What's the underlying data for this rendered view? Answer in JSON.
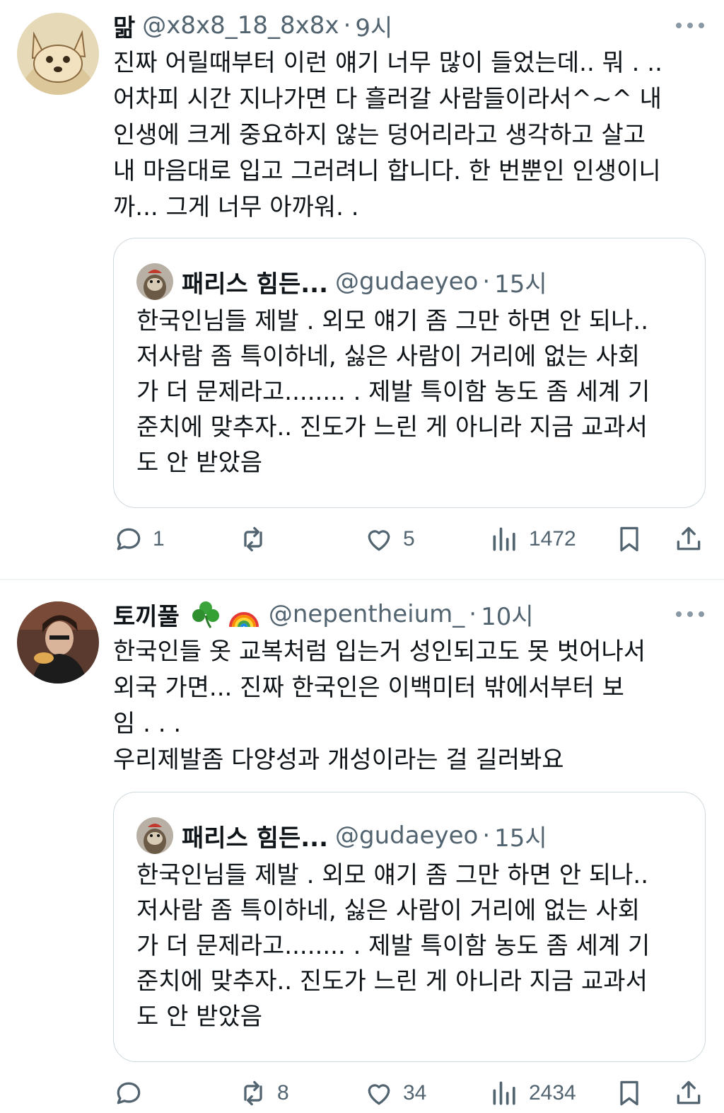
{
  "tweets": [
    {
      "author": "맒",
      "handle": "@x8x8_18_8x8x",
      "dot": "·",
      "time": "9시",
      "body_lines": [
        "진짜 어릴때부터 이런 얘기 너무 많이 들었는데.. 뭐 . ..",
        "어차피 시간 지나가면 다 흘러갈 사람들이라서^~^ 내",
        "인생에 크게 중요하지 않는 덩어리라고 생각하고 살고",
        "내 마음대로 입고 그러려니 합니다. 한 번뿐인 인생이니",
        "까... 그게 너무 아까워. ."
      ],
      "quote": {
        "author": "패리스 힘든...",
        "handle": "@gudaeyeo",
        "dot": "·",
        "time": "15시",
        "lines": [
          "한국인님들 제발 . 외모 얘기 좀 그만 하면 안 되나..",
          "저사람 좀 특이하네, 싫은 사람이 거리에 없는 사회",
          "가 더 문제라고........ . 제발 특이함 농도 좀 세계 기",
          "준치에 맞추자.. 진도가 느린 게 아니라 지금 교과서",
          "도 안 받았음"
        ]
      },
      "actions": {
        "replies": "1",
        "reposts": "",
        "likes": "5",
        "views": "1472"
      }
    },
    {
      "author": "토끼풀",
      "author_emoji": [
        "shamrock-icon",
        "rainbow-icon"
      ],
      "handle": "@nepentheium_",
      "dot": "·",
      "time": "10시",
      "body_lines": [
        "한국인들 옷 교복처럼 입는거 성인되고도 못 벗어나서",
        "외국 가면... 진짜 한국인은 이백미터 밖에서부터 보",
        "임 . . .",
        "우리제발좀 다양성과 개성이라는 걸 길러봐요"
      ],
      "quote": {
        "author": "패리스 힘든...",
        "handle": "@gudaeyeo",
        "dot": "·",
        "time": "15시",
        "lines": [
          "한국인님들 제발 . 외모 얘기 좀 그만 하면 안 되나..",
          "저사람 좀 특이하네, 싫은 사람이 거리에 없는 사회",
          "가 더 문제라고........ . 제발 특이함 농도 좀 세계 기",
          "준치에 맞추자.. 진도가 느린 게 아니라 지금 교과서",
          "도 안 받았음"
        ]
      },
      "actions": {
        "replies": "",
        "reposts": "8",
        "likes": "34",
        "views": "2434"
      }
    }
  ],
  "colors": {
    "text": "#0f1419",
    "muted": "#536471",
    "border": "#cfd9de",
    "divider": "#eff3f4"
  }
}
